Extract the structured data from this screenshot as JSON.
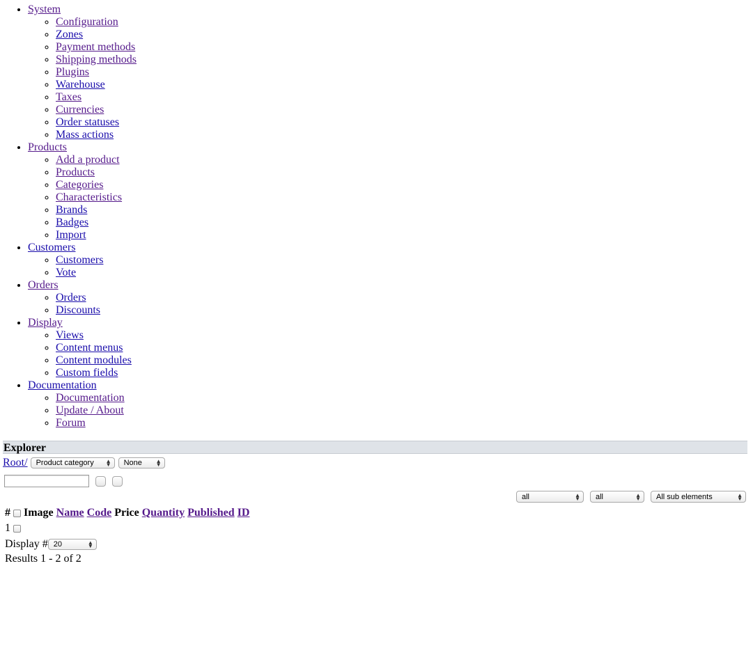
{
  "menu": [
    {
      "label": " System",
      "items": [
        " Configuration",
        " Zones",
        " Payment methods",
        " Shipping methods",
        " Plugins",
        " Warehouse",
        " Taxes",
        " Currencies",
        " Order statuses",
        " Mass actions"
      ]
    },
    {
      "label": " Products",
      "items": [
        " Add a product",
        " Products",
        " Categories",
        " Characteristics",
        " Brands",
        " Badges",
        " Import"
      ]
    },
    {
      "label": " Customers",
      "items": [
        " Customers",
        " Vote"
      ]
    },
    {
      "label": " Orders",
      "items": [
        " Orders",
        " Discounts"
      ]
    },
    {
      "label": " Display",
      "items": [
        " Views",
        " Content menus",
        " Content modules",
        " Custom fields"
      ]
    },
    {
      "label": " Documentation",
      "items": [
        " Documentation",
        " Update / About",
        " Forum"
      ]
    }
  ],
  "explorer": {
    "title": "Explorer",
    "breadcrumb_root": "Root/",
    "category_select": "Product category",
    "none_select": "None",
    "search_value": "",
    "filters": {
      "filter1": "all",
      "filter2": "all",
      "filter3": "All sub elements"
    },
    "table": {
      "hash_label": "#",
      "columns": [
        "Image",
        "Name",
        "Code",
        "Price",
        "Quantity",
        "Published",
        "ID"
      ],
      "rows": [
        {
          "index": "1"
        }
      ]
    },
    "display_label": "Display #",
    "display_value": "20",
    "results": "Results 1 - 2 of 2"
  },
  "colors": {
    "link": "#1a0dab",
    "visited": "#551a8b",
    "header_bg": "#dfe3e8"
  }
}
